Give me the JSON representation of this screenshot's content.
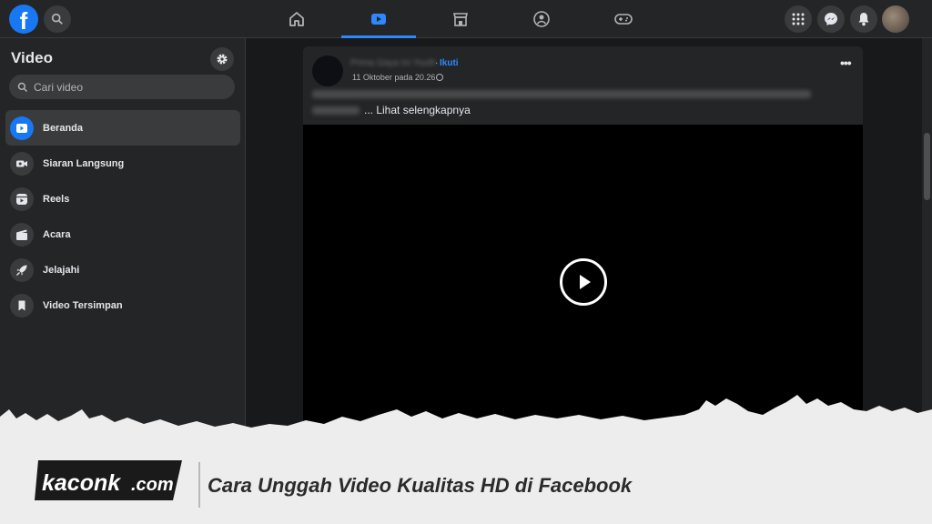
{
  "topbar": {
    "logo_letter": "f",
    "nav": [
      {
        "name": "home",
        "active": false
      },
      {
        "name": "video",
        "active": true
      },
      {
        "name": "marketplace",
        "active": false
      },
      {
        "name": "groups",
        "active": false
      },
      {
        "name": "gaming",
        "active": false
      }
    ],
    "right_icons": [
      "menu-grid-icon",
      "messenger-icon",
      "notifications-bell-icon",
      "account-avatar"
    ]
  },
  "sidebar": {
    "title": "Video",
    "search_placeholder": "Cari video",
    "items": [
      {
        "label": "Beranda",
        "icon": "video-play-icon",
        "active": true
      },
      {
        "label": "Siaran Langsung",
        "icon": "live-camera-icon",
        "active": false
      },
      {
        "label": "Reels",
        "icon": "reels-icon",
        "active": false
      },
      {
        "label": "Acara",
        "icon": "clapperboard-icon",
        "active": false
      },
      {
        "label": "Jelajahi",
        "icon": "rocket-icon",
        "active": false
      },
      {
        "label": "Video Tersimpan",
        "icon": "bookmark-icon",
        "active": false
      }
    ]
  },
  "post": {
    "author": "Prima Gaya Ini Youth",
    "separator": "·",
    "follow_label": "Ikuti",
    "timestamp": "11 Oktober pada 20.26",
    "see_more": "... Lihat selengkapnya",
    "more_label": "•••"
  },
  "banner": {
    "brand_prefix": "kaconk",
    "brand_suffix": ".com",
    "headline": "Cara Unggah Video Kualitas HD di Facebook"
  },
  "colors": {
    "accent": "#1877f2",
    "link": "#2d88ff",
    "surface": "#242526",
    "background": "#18191a",
    "banner": "#ededed"
  }
}
